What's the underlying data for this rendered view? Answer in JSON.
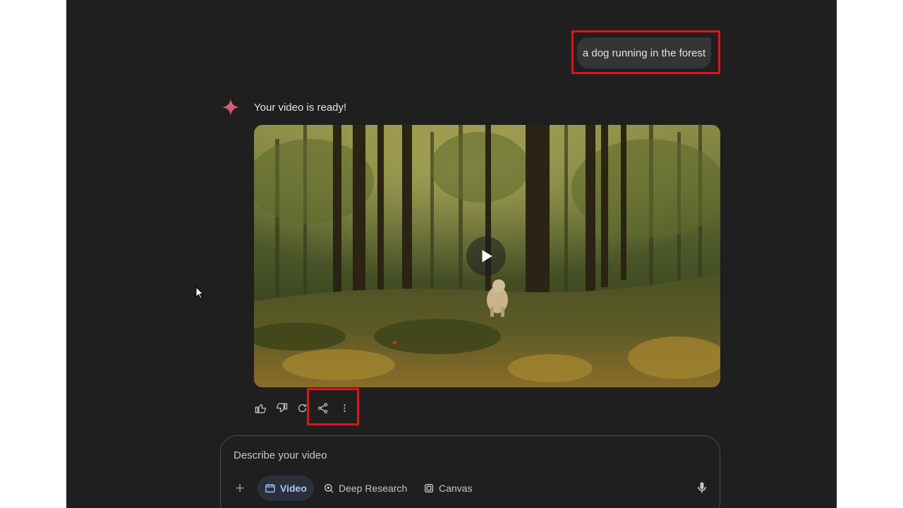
{
  "conversation": {
    "user_prompt": "a dog running in the forest",
    "response_text": "Your video is ready!"
  },
  "actions": {
    "icons": [
      "thumb-up-icon",
      "thumb-down-icon",
      "regenerate-icon",
      "share-icon",
      "more-vert-icon"
    ]
  },
  "input": {
    "placeholder": "Describe your video",
    "tools": {
      "video": "Video",
      "deep_research": "Deep Research",
      "canvas": "Canvas"
    }
  },
  "colors": {
    "background": "#1f1f1f",
    "bubble": "#333537",
    "accent": "#a8c7fa",
    "highlight": "#e0131a",
    "spark": "#d96570"
  }
}
